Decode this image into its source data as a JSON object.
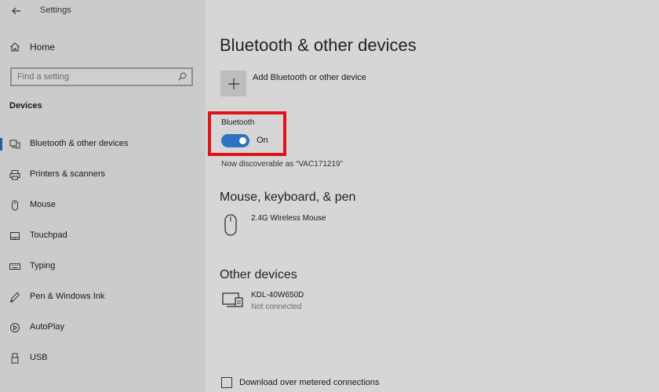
{
  "window": {
    "title": "Settings"
  },
  "sidebar": {
    "home_label": "Home",
    "search_placeholder": "Find a setting",
    "section_title": "Devices",
    "items": [
      {
        "label": "Bluetooth & other devices",
        "icon": "bluetooth-devices-icon",
        "active": true
      },
      {
        "label": "Printers & scanners",
        "icon": "printer-icon"
      },
      {
        "label": "Mouse",
        "icon": "mouse-icon"
      },
      {
        "label": "Touchpad",
        "icon": "touchpad-icon"
      },
      {
        "label": "Typing",
        "icon": "keyboard-icon"
      },
      {
        "label": "Pen & Windows Ink",
        "icon": "pen-icon"
      },
      {
        "label": "AutoPlay",
        "icon": "autoplay-icon"
      },
      {
        "label": "USB",
        "icon": "usb-icon"
      }
    ]
  },
  "main": {
    "title": "Bluetooth & other devices",
    "add_device_label": "Add Bluetooth or other device",
    "bluetooth": {
      "label": "Bluetooth",
      "state": "On",
      "discoverable_text": "Now discoverable as “VAC171219”"
    },
    "mouse_section": {
      "title": "Mouse, keyboard, & pen",
      "devices": [
        {
          "name": "2.4G Wireless Mouse",
          "icon": "mouse-icon"
        }
      ]
    },
    "other_section": {
      "title": "Other devices",
      "devices": [
        {
          "name": "KDL-40W650D",
          "status": "Not connected",
          "icon": "display-device-icon"
        }
      ]
    },
    "metered_label": "Download over metered connections"
  },
  "colors": {
    "accent": "#2d73c2",
    "highlight": "#e0121c",
    "sidebar_bg": "#cbcbcb",
    "main_bg": "#d6d6d6"
  }
}
